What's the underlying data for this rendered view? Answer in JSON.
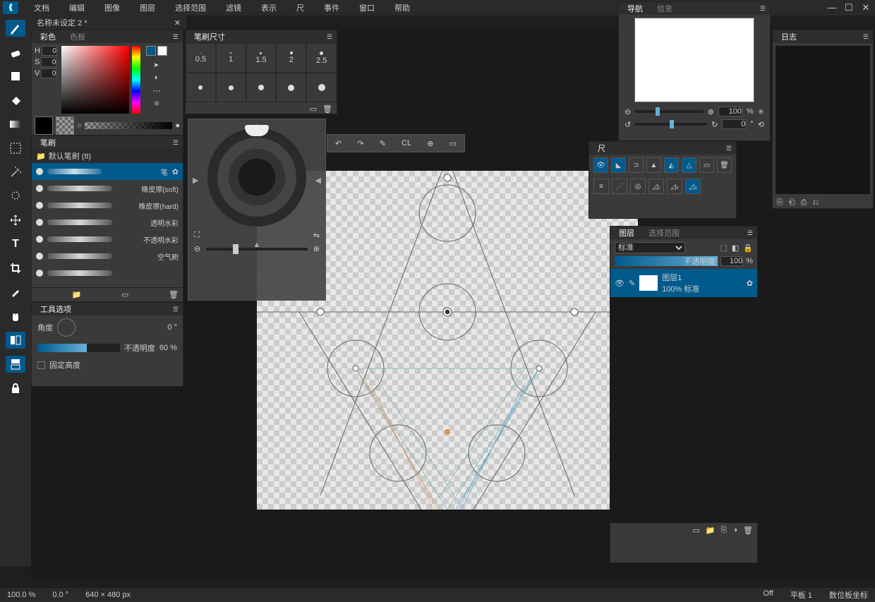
{
  "menu": {
    "items": [
      "文档",
      "编辑",
      "图像",
      "图层",
      "选择范围",
      "滤镜",
      "表示",
      "尺",
      "事件",
      "窗口",
      "帮助"
    ]
  },
  "doc_tab": {
    "title": "名称未设定 2 *"
  },
  "color_panel": {
    "tabs": [
      "彩色",
      "色板"
    ],
    "h_label": "H",
    "s_label": "S",
    "v_label": "V",
    "h": "0",
    "s": "0",
    "v": "0"
  },
  "brush_panel": {
    "title": "笔刷",
    "category": "默认笔刷 (8)",
    "brushes": [
      "笔",
      "橡皮擦(soft)",
      "橡皮擦(hard)",
      "透明水彩",
      "不透明水彩",
      "空气刷"
    ]
  },
  "tool_opts": {
    "title": "工具选项",
    "angle_label": "角度",
    "angle_val": "0",
    "angle_unit": "°",
    "opacity_label": "不透明度",
    "opacity_val": "60",
    "opacity_unit": "%",
    "fixed_height": "固定高度"
  },
  "brush_size": {
    "title": "笔刷尺寸",
    "sizes": [
      "0.5",
      "1",
      "1.5",
      "2",
      "2.5"
    ]
  },
  "navigator": {
    "tabs": [
      "导航",
      "信息"
    ],
    "zoom": "100",
    "zoom_unit": "%",
    "angle": "0",
    "angle_unit": "°"
  },
  "ruler_panel": {
    "title": "尺"
  },
  "journal_panel": {
    "title": "日志"
  },
  "layers_panel": {
    "tabs": [
      "图层",
      "选择范围"
    ],
    "blend_mode": "标准",
    "opacity_label": "不透明度",
    "opacity_val": "100",
    "opacity_unit": "%",
    "layer": {
      "name": "图层1",
      "info": "100% 标准"
    }
  },
  "status": {
    "zoom": "100.0 %",
    "angle": "0.0 °",
    "dims": "640 × 480 px",
    "cl": "Off",
    "tablet": "平板 1",
    "coord": "数位板坐标"
  },
  "qtool": {
    "cl": "CL"
  }
}
